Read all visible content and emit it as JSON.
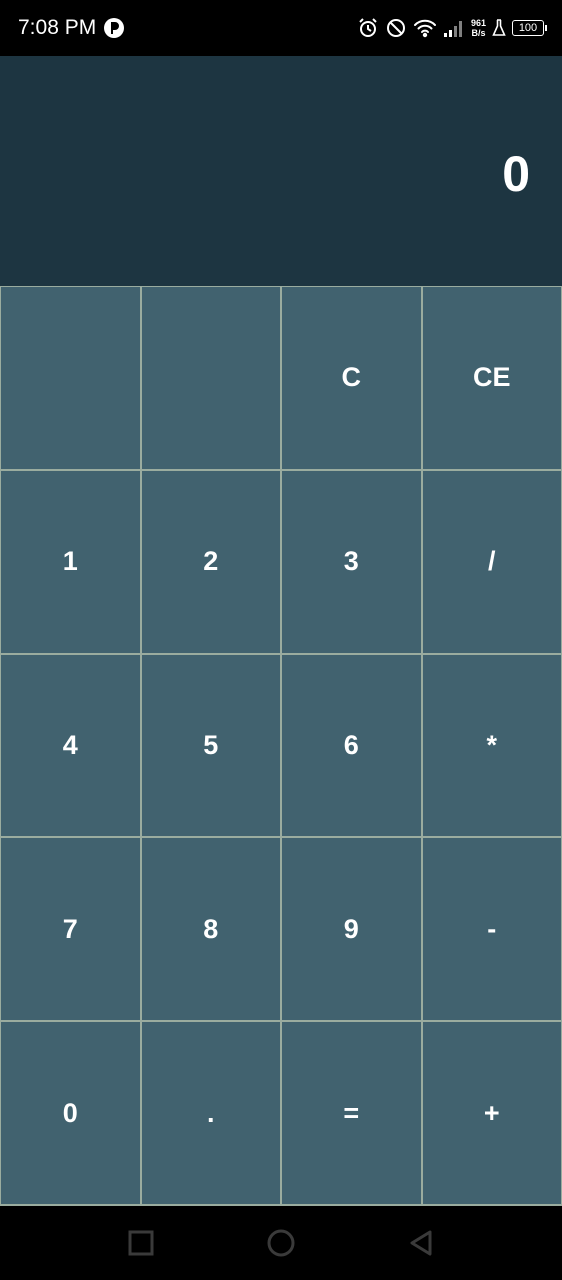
{
  "status_bar": {
    "time": "7:08 PM",
    "net_speed_value": "961",
    "net_speed_unit": "B/s",
    "battery": "100",
    "icons": [
      "app-icon",
      "alarm-icon",
      "dnd-icon",
      "wifi-icon",
      "signal-icon",
      "flask-icon",
      "battery-icon"
    ]
  },
  "display": {
    "value": "0"
  },
  "keypad": {
    "rows": [
      [
        "",
        "",
        "C",
        "CE"
      ],
      [
        "1",
        "2",
        "3",
        "/"
      ],
      [
        "4",
        "5",
        "6",
        "*"
      ],
      [
        "7",
        "8",
        "9",
        "-"
      ],
      [
        "0",
        ".",
        "=",
        "+"
      ]
    ]
  },
  "nav_bar": {
    "icons": [
      "recents-icon",
      "home-icon",
      "back-icon"
    ]
  },
  "colors": {
    "display_bg": "#1d3541",
    "key_bg": "#41626f",
    "grid_lines": "#9aac9f",
    "text": "#ffffff"
  }
}
